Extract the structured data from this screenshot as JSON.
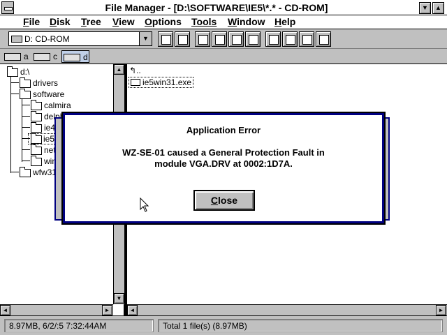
{
  "window": {
    "title": "File Manager - [D:\\SOFTWARE\\IE5\\*.* - CD-ROM]"
  },
  "menu": [
    {
      "label": "File",
      "ul": "F",
      "rest": "ile"
    },
    {
      "label": "Disk",
      "ul": "D",
      "rest": "isk"
    },
    {
      "label": "Tree",
      "ul": "T",
      "rest": "ree"
    },
    {
      "label": "View",
      "ul": "V",
      "rest": "iew"
    },
    {
      "label": "Options",
      "ul": "O",
      "rest": "ptions"
    },
    {
      "label": "Tools",
      "ul": "",
      "rest": "Tools"
    },
    {
      "label": "Window",
      "ul": "W",
      "rest": "indow"
    },
    {
      "label": "Help",
      "ul": "H",
      "rest": "elp"
    }
  ],
  "toolbar": {
    "drive_value": "D: CD-ROM"
  },
  "drives": [
    {
      "letter": "a",
      "selected": false
    },
    {
      "letter": "c",
      "selected": false
    },
    {
      "letter": "d",
      "selected": true
    }
  ],
  "tree": {
    "root": "d:\\",
    "items": [
      "drivers",
      "software",
      "calmira",
      "delphi",
      "ie4",
      "ie5",
      "net",
      "win",
      "wfw311"
    ]
  },
  "files": {
    "up": "..",
    "items": [
      "ie5win31.exe"
    ]
  },
  "status": {
    "left": "8.97MB, 6/2/:5 7:32:44AM",
    "right": "Total 1 file(s) (8.97MB)"
  },
  "dialog": {
    "title": "Application Error",
    "message_line1": "WZ-SE-01 caused a General Protection Fault in",
    "message_line2": "module VGA.DRV at 0002:1D7A.",
    "button_ul": "C",
    "button_rest": "lose"
  }
}
